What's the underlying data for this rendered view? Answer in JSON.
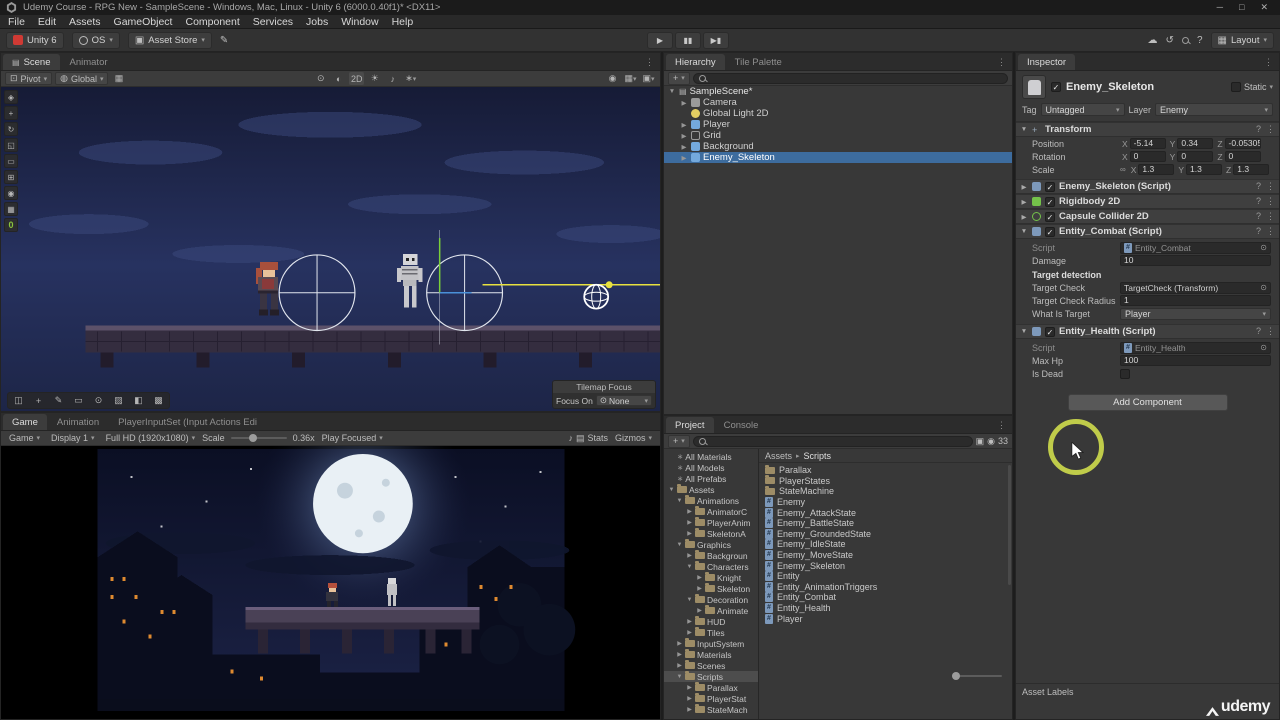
{
  "title_bar": {
    "title": "Udemy Course - RPG New - SampleScene - Windows, Mac, Linux - Unity 6 (6000.0.40f1)* <DX11>"
  },
  "window_controls": {
    "minimize": "─",
    "maximize": "□",
    "close": "✕"
  },
  "menu": {
    "items": [
      "File",
      "Edit",
      "Assets",
      "GameObject",
      "Component",
      "Services",
      "Jobs",
      "Window",
      "Help"
    ]
  },
  "toolbar": {
    "unity_button": "Unity 6",
    "os_button": "OS",
    "asset_store_button": "Asset Store",
    "layout_button": "Layout"
  },
  "icons": {
    "caret": "▾",
    "fold_open": "▼",
    "fold_closed": "▶",
    "play": "▶",
    "pause": "▮▮",
    "step": "▶▮",
    "kebab": "⋮",
    "cloud": "☁",
    "history": "↺",
    "help": "?",
    "plus": "+",
    "crumb_sep": "▸",
    "scene_glyph": "▤",
    "sun": "☀",
    "note": "♪",
    "fx": "∗",
    "eye": "◉",
    "half": "◐",
    "target": "⊙",
    "grid": "▦",
    "camera": "▣",
    "brush": "✎",
    "check": "✓",
    "link": "∞",
    "d2": "2D",
    "pivot_glyph": "⊡",
    "globe_glyph": "◍"
  },
  "scene_view": {
    "tab_scene": "Scene",
    "tab_animator": "Animator",
    "pivot": "Pivot",
    "global": "Global",
    "layer_badge": "0",
    "tools_left": [
      "◈",
      "+",
      "↻",
      "◱",
      "▭",
      "⊞",
      "◉",
      "▦"
    ],
    "tilemap_tools": [
      "◫",
      "+",
      "✎",
      "▭",
      "⊙",
      "▨",
      "◧",
      "▩"
    ],
    "tilemap_focus_title": "Tilemap Focus",
    "focus_on_label": "Focus On",
    "focus_value": "None"
  },
  "game_view": {
    "tab_game": "Game",
    "tab_animation": "Animation",
    "tab_input": "PlayerInputSet (Input Actions Edi",
    "menu_game": "Game",
    "display": "Display 1",
    "resolution": "Full HD (1920x1080)",
    "scale_label": "Scale",
    "scale_value": "0.36x",
    "play_focused": "Play Focused",
    "stats": "Stats",
    "gizmos": "Gizmos"
  },
  "hierarchy": {
    "tab_hierarchy": "Hierarchy",
    "tab_tile_palette": "Tile Palette",
    "root": "SampleScene*",
    "items": [
      {
        "label": "Camera"
      },
      {
        "label": "Global Light 2D"
      },
      {
        "label": "Player"
      },
      {
        "label": "Grid"
      },
      {
        "label": "Background"
      },
      {
        "label": "Enemy_Skeleton"
      }
    ]
  },
  "project": {
    "tab_project": "Project",
    "tab_console": "Console",
    "hidden_badge": "33",
    "crumb_root": "Assets",
    "crumb_current": "Scripts",
    "tree": [
      {
        "label": "All Materials"
      },
      {
        "label": "All Models"
      },
      {
        "label": "All Prefabs"
      },
      {
        "label": "Assets"
      },
      {
        "label": "Animations"
      },
      {
        "label": "AnimatorC"
      },
      {
        "label": "PlayerAnim"
      },
      {
        "label": "SkeletonA"
      },
      {
        "label": "Graphics"
      },
      {
        "label": "Backgroun"
      },
      {
        "label": "Characters"
      },
      {
        "label": "Knight"
      },
      {
        "label": "Skeleton"
      },
      {
        "label": "Decoration"
      },
      {
        "label": "Animate"
      },
      {
        "label": "HUD"
      },
      {
        "label": "Tiles"
      },
      {
        "label": "InputSystem"
      },
      {
        "label": "Materials"
      },
      {
        "label": "Scenes"
      },
      {
        "label": "Scripts"
      },
      {
        "label": "Parallax"
      },
      {
        "label": "PlayerStat"
      },
      {
        "label": "StateMach"
      }
    ],
    "files": [
      {
        "name": "Parallax"
      },
      {
        "name": "PlayerStates"
      },
      {
        "name": "StateMachine"
      },
      {
        "name": "Enemy"
      },
      {
        "name": "Enemy_AttackState"
      },
      {
        "name": "Enemy_BattleState"
      },
      {
        "name": "Enemy_GroundedState"
      },
      {
        "name": "Enemy_IdleState"
      },
      {
        "name": "Enemy_MoveState"
      },
      {
        "name": "Enemy_Skeleton"
      },
      {
        "name": "Entity"
      },
      {
        "name": "Entity_AnimationTriggers"
      },
      {
        "name": "Entity_Combat"
      },
      {
        "name": "Entity_Health"
      },
      {
        "name": "Player"
      }
    ]
  },
  "inspector": {
    "tab": "Inspector",
    "name": "Enemy_Skeleton",
    "static_label": "Static",
    "tag_label": "Tag",
    "tag_value": "Untagged",
    "layer_label": "Layer",
    "layer_value": "Enemy",
    "axis": {
      "x": "X",
      "y": "Y",
      "z": "Z"
    },
    "transform": {
      "title": "Transform",
      "position_label": "Position",
      "rotation_label": "Rotation",
      "scale_label": "Scale",
      "position": {
        "x": "-5.14",
        "y": "0.34",
        "z": "-0.05305"
      },
      "rotation": {
        "x": "0",
        "y": "0",
        "z": "0"
      },
      "scale": {
        "x": "1.3",
        "y": "1.3",
        "z": "1.3"
      }
    },
    "script_component": "Enemy_Skeleton (Script)",
    "rigidbody": "Rigidbody 2D",
    "capsule": "Capsule Collider 2D",
    "entity_combat": {
      "title": "Entity_Combat (Script)",
      "script_label": "Script",
      "script_value": "Entity_Combat",
      "damage_label": "Damage",
      "damage_value": "10",
      "section_label": "Target detection",
      "target_check_label": "Target Check",
      "target_check_value": "TargetCheck (Transform)",
      "radius_label": "Target Check Radius",
      "radius_value": "1",
      "what_label": "What Is Target",
      "what_value": "Player"
    },
    "entity_health": {
      "title": "Entity_Health (Script)",
      "script_label": "Script",
      "script_value": "Entity_Health",
      "maxhp_label": "Max Hp",
      "maxhp_value": "100",
      "isdead_label": "Is Dead"
    },
    "add_component": "Add Component",
    "asset_labels": "Asset Labels"
  },
  "watermark": "udemy"
}
